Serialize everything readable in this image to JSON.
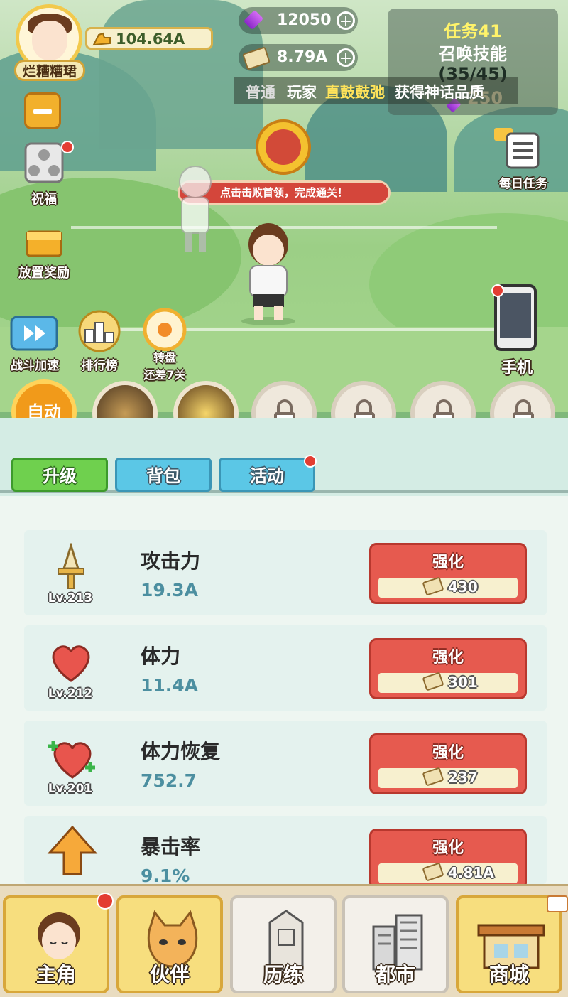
{
  "player": {
    "name": "烂糟糟珺",
    "power": "104.64A"
  },
  "currency": {
    "gems": "12050",
    "cash": "8.79A"
  },
  "task": {
    "title": "任务41",
    "desc": "召唤技能",
    "progress": "(35/45)",
    "reward": "250"
  },
  "broadcast": {
    "tag": "普通",
    "prefix": "玩家",
    "player": "直鼓鼓弛",
    "suffix": "获得神话品质"
  },
  "side_left": [
    {
      "label": "祝福",
      "icon": "blessing-icon"
    },
    {
      "label": "放置奖励",
      "icon": "treasure-chest-icon"
    }
  ],
  "side_right": [
    {
      "label": "每日任务",
      "icon": "daily-task-icon"
    },
    {
      "label": "手机",
      "icon": "phone-icon"
    }
  ],
  "row_icons": [
    {
      "label": "战斗加速",
      "icon": "speed-up-icon"
    },
    {
      "label": "排行榜",
      "icon": "leaderboard-icon"
    },
    {
      "label": "转盘",
      "sub": "还差7关",
      "icon": "wheel-icon"
    }
  ],
  "boss": {
    "hint": "点击击败首领，完成通关！"
  },
  "skills": {
    "auto_label": "自动"
  },
  "tabs": [
    {
      "label": "升级",
      "active": true
    },
    {
      "label": "背包",
      "active": false
    },
    {
      "label": "活动",
      "active": false
    }
  ],
  "stats": [
    {
      "name": "攻击力",
      "value": "19.3A",
      "level": "Lv.213",
      "cost": "430",
      "button": "强化",
      "icon": "sword-icon"
    },
    {
      "name": "体力",
      "value": "11.4A",
      "level": "Lv.212",
      "cost": "301",
      "button": "强化",
      "icon": "heart-icon"
    },
    {
      "name": "体力恢复",
      "value": "752.7",
      "level": "Lv.201",
      "cost": "237",
      "button": "强化",
      "icon": "heart-plus-icon"
    },
    {
      "name": "暴击率",
      "value": "9.1%",
      "level": "",
      "cost": "4.81A",
      "button": "强化",
      "icon": "crit-arrow-icon"
    }
  ],
  "nav": [
    {
      "label": "主角",
      "icon": "hero-icon"
    },
    {
      "label": "伙伴",
      "icon": "cat-icon"
    },
    {
      "label": "历练",
      "icon": "tablet-icon"
    },
    {
      "label": "都市",
      "icon": "city-icon"
    },
    {
      "label": "商城",
      "icon": "shop-icon"
    }
  ],
  "colors": {
    "accent_gold": "#f2c94c",
    "upgrade_red": "#e65a4f",
    "tab_green": "#6fd04e",
    "tab_blue": "#5bc7e6"
  }
}
